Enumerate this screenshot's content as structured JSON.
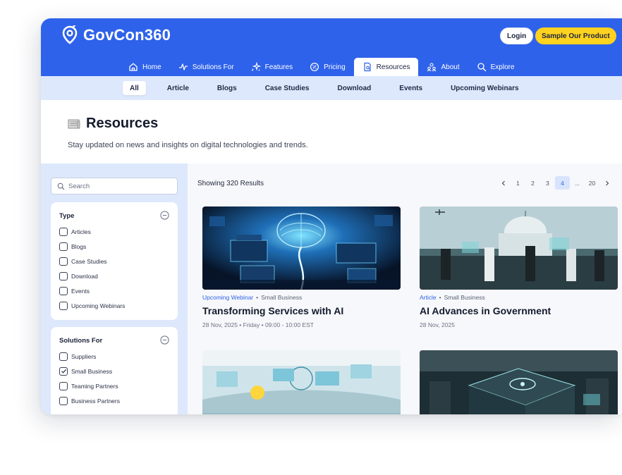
{
  "brand": {
    "name": "GovCon360"
  },
  "header": {
    "login_label": "Login",
    "sample_label": "Sample Our Product"
  },
  "nav": [
    {
      "label": "Home",
      "icon": "home-icon"
    },
    {
      "label": "Solutions For",
      "icon": "pulse-icon"
    },
    {
      "label": "Features",
      "icon": "sparkle-icon"
    },
    {
      "label": "Pricing",
      "icon": "percent-badge-icon"
    },
    {
      "label": "Resources",
      "icon": "document-search-icon",
      "active": true
    },
    {
      "label": "About",
      "icon": "team-icon"
    },
    {
      "label": "Explore",
      "icon": "search-icon"
    }
  ],
  "subnav": [
    {
      "label": "All",
      "active": true
    },
    {
      "label": "Article"
    },
    {
      "label": "Blogs"
    },
    {
      "label": "Case Studies"
    },
    {
      "label": "Download"
    },
    {
      "label": "Events"
    },
    {
      "label": "Upcoming Webinars"
    }
  ],
  "page": {
    "title": "Resources",
    "subtitle": "Stay updated on news and insights on digital technologies and trends."
  },
  "sidebar": {
    "search_placeholder": "Search",
    "filters": [
      {
        "title": "Type",
        "options": [
          {
            "label": "Articles",
            "checked": false
          },
          {
            "label": "Blogs",
            "checked": false
          },
          {
            "label": "Case Studies",
            "checked": false
          },
          {
            "label": "Download",
            "checked": false
          },
          {
            "label": "Events",
            "checked": false
          },
          {
            "label": "Upcoming Webinars",
            "checked": false
          }
        ]
      },
      {
        "title": "Solutions For",
        "options": [
          {
            "label": "Suppliers",
            "checked": false
          },
          {
            "label": "Small Business",
            "checked": true
          },
          {
            "label": "Teaming Partners",
            "checked": false
          },
          {
            "label": "Business Partners",
            "checked": false
          }
        ]
      }
    ]
  },
  "results": {
    "label": "Showing 320 Results",
    "pages": [
      "1",
      "2",
      "3",
      "4",
      "...",
      "20"
    ],
    "current_page": "4"
  },
  "cards": [
    {
      "category": "Upcoming Webinar",
      "tag": "Small Business",
      "title": "Transforming Services with AI",
      "date": "28 Nov, 2025 • Friday • 09:00 - 10:00 EST"
    },
    {
      "category": "Article",
      "tag": "Small Business",
      "title": "AI Advances in Government",
      "date": "28 Nov, 2025"
    },
    {
      "category": "",
      "tag": "",
      "title": "",
      "date": ""
    },
    {
      "category": "",
      "tag": "",
      "title": "",
      "date": ""
    }
  ],
  "colors": {
    "primary": "#2f62ea",
    "accent": "#ffd21f",
    "subnav_bg": "#dde8fd"
  }
}
